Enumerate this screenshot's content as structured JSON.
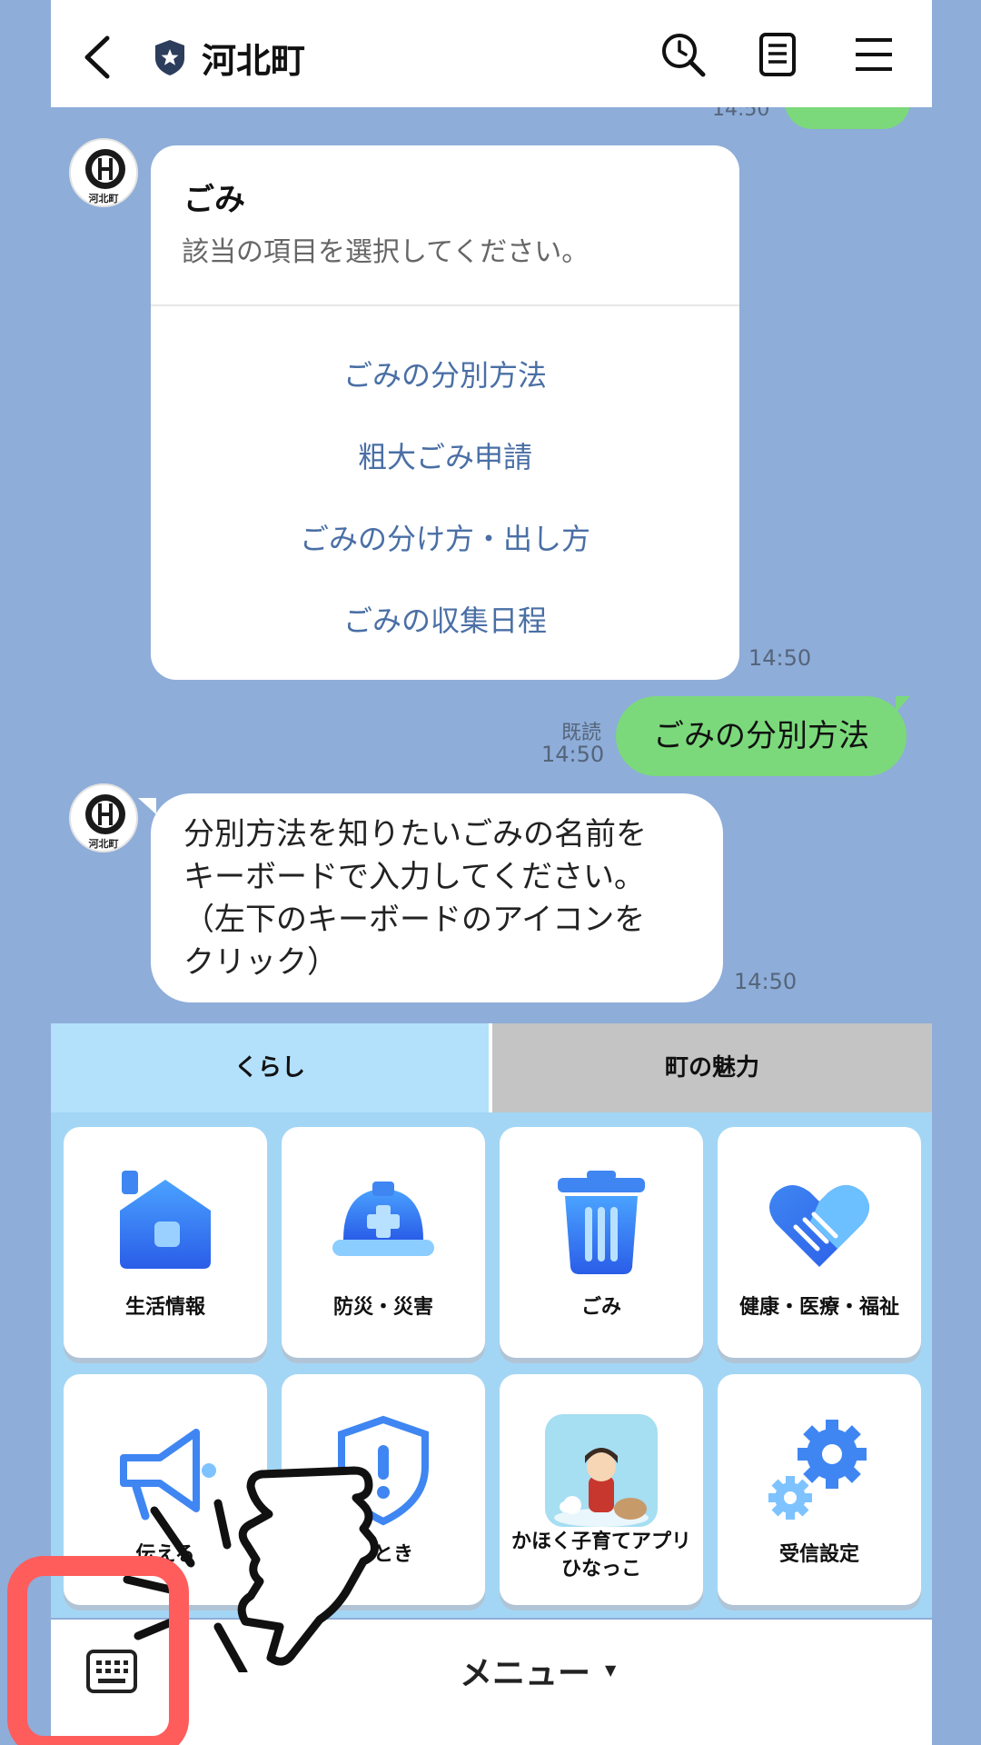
{
  "header": {
    "title": "河北町",
    "back_icon": "chevron-left-icon",
    "badge_icon": "shield-star-icon",
    "search_icon": "search-clock-icon",
    "notes_icon": "notes-icon",
    "menu_icon": "hamburger-icon"
  },
  "chat": {
    "peek_time": "14:50",
    "avatar_label": "河北町",
    "card": {
      "title": "ごみ",
      "subtitle": "該当の項目を選択してください。",
      "options": [
        "ごみの分別方法",
        "粗大ごみ申請",
        "ごみの分け方・出し方",
        "ごみの収集日程"
      ],
      "time": "14:50"
    },
    "outgoing": {
      "text": "ごみの分別方法",
      "read": "既読",
      "time": "14:50"
    },
    "incoming": {
      "lines": [
        "分別方法を知りたいごみの名前を",
        "キーボードで入力してください。",
        "（左下のキーボードのアイコンを",
        "クリック）"
      ],
      "time": "14:50"
    }
  },
  "rich_menu": {
    "tabs": [
      "くらし",
      "町の魅力"
    ],
    "active_tab": "くらし",
    "tiles": [
      {
        "label": "生活情報",
        "icon": "house-icon"
      },
      {
        "label": "防災・災害",
        "icon": "helmet-icon"
      },
      {
        "label": "ごみ",
        "icon": "trash-icon"
      },
      {
        "label": "健康・医療・福祉",
        "icon": "heart-handshake-icon"
      },
      {
        "label": "伝える",
        "icon": "megaphone-icon"
      },
      {
        "label": "のとき",
        "icon": "shield-alert-icon"
      },
      {
        "label_lines": [
          "かほく子育てアプリ",
          "ひなっこ"
        ],
        "icon": "hinakko-app-icon"
      },
      {
        "label": "受信設定",
        "icon": "gear-icon"
      }
    ],
    "hinakko_banner_lines": [
      "かほく子育てアプリ",
      "ひなっこ"
    ]
  },
  "bottom_bar": {
    "keyboard_icon": "keyboard-icon",
    "menu_label": "メニュー",
    "caret": "▼"
  },
  "colors": {
    "chat_bg": "#8eadd9",
    "green_bubble": "#7bd97b",
    "link_blue": "#4a6fa5",
    "menu_bg": "#a3d6f5",
    "highlight_red": "#ff5c5c"
  }
}
